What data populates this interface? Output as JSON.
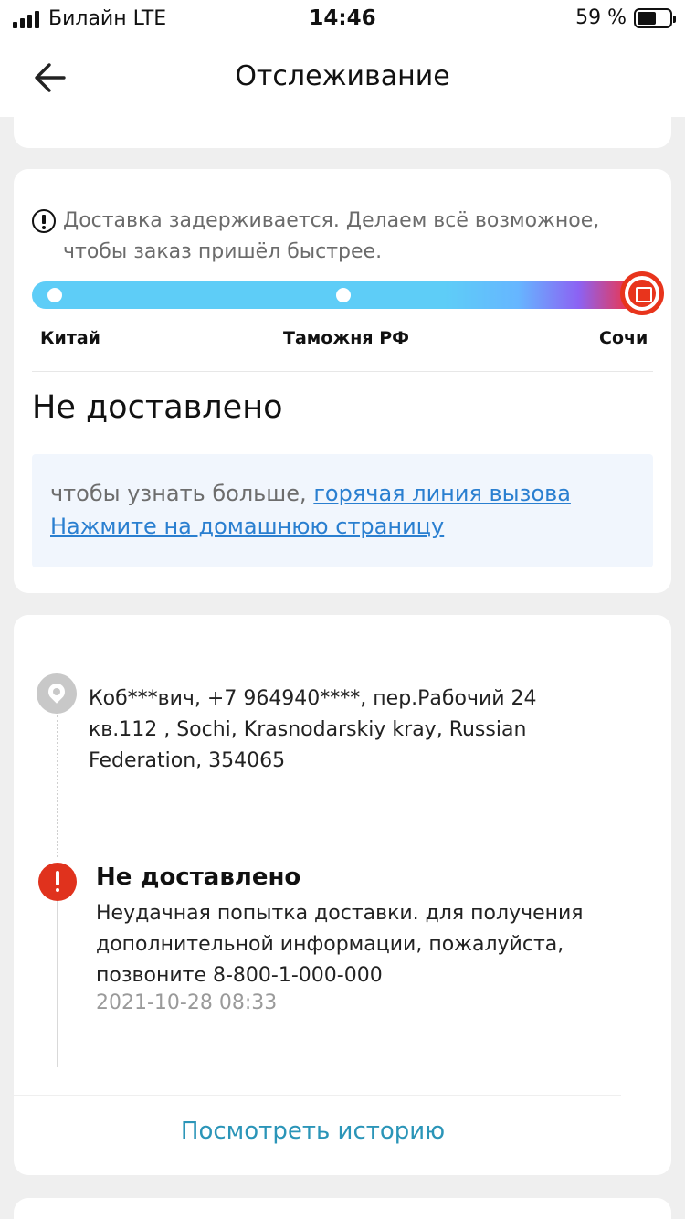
{
  "status_bar": {
    "carrier": "Билайн  LTE",
    "time": "14:46",
    "battery_percent": "59 %",
    "battery_level": 0.59
  },
  "nav": {
    "title": "Отслеживание",
    "back_icon": "arrow-left-icon"
  },
  "tracking": {
    "notice": "Доставка задерживается. Делаем всё возможное, чтобы заказ пришёл быстрее.",
    "notice_icon": "exclamation-circle-icon",
    "stops": [
      "Китай",
      "Таможня РФ",
      "Сочи"
    ],
    "current_stop_icon": "package-icon",
    "status": "Не доставлено",
    "info_prefix": "чтобы узнать больше,",
    "info_link_hotline": "горячая линия вызова",
    "info_link_home": "Нажмите на домашнюю страницу"
  },
  "timeline": {
    "location_icon": "map-pin-icon",
    "address": "Коб***вич,  +7 964940****,  пер.Рабочий 24 кв.112 ,  Sochi,  Krasnodarskiy kray,  Russian Federation,  354065",
    "events": [
      {
        "icon": "error-icon",
        "title": "Не доставлено",
        "description": "Неудачная попытка доставки. для получения дополнительной информации, пожалуйста, позвоните 8-800-1-000-000",
        "time": "2021-10-28 08:33"
      }
    ],
    "history_button": "Посмотреть историю"
  },
  "colors": {
    "accent_red": "#e8341c",
    "link_blue": "#2a7fd0",
    "history_blue": "#2b95b8",
    "progress_cyan": "#5ecdf7"
  }
}
